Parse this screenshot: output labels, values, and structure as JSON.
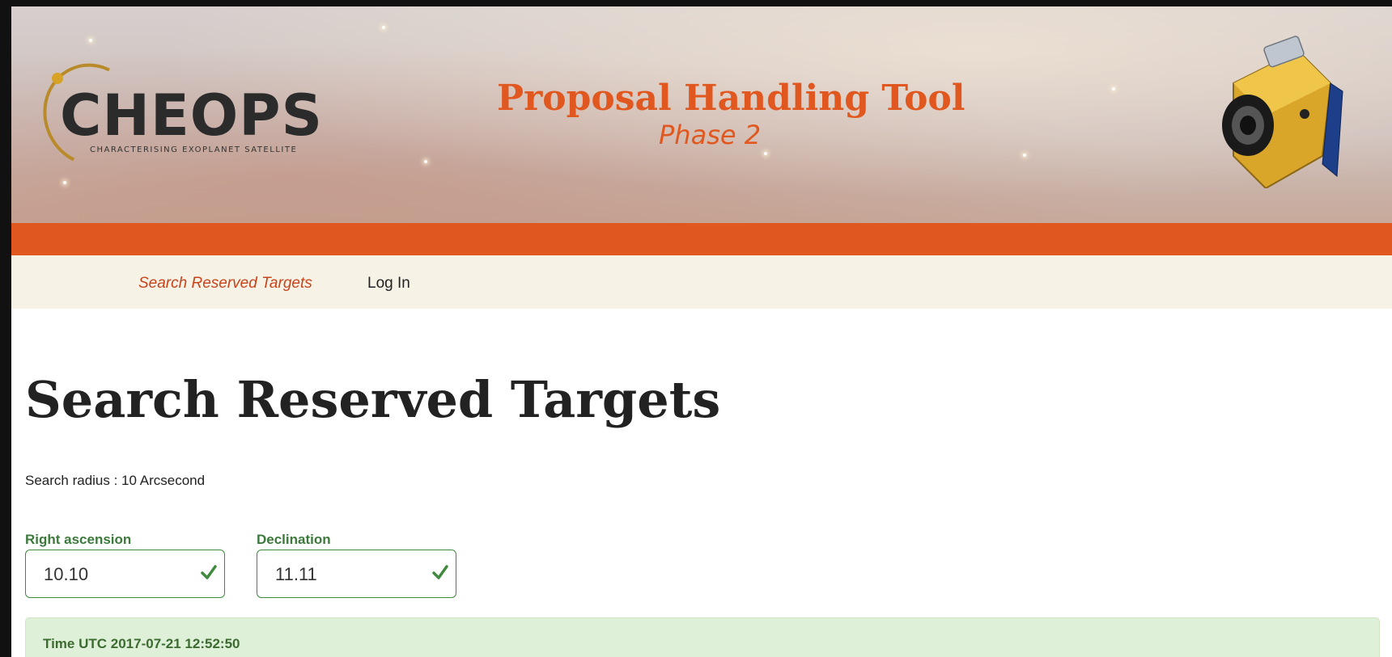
{
  "header": {
    "logo_text": "CHEOPS",
    "logo_subtitle": "CHARACTERISING EXOPLANET SATELLITE",
    "tool_title": "Proposal Handling Tool",
    "tool_subtitle": "Phase 2",
    "satellite_icon": "satellite-icon"
  },
  "nav": {
    "items": [
      {
        "label": "Search Reserved Targets",
        "active": true
      },
      {
        "label": "Log In",
        "active": false
      }
    ]
  },
  "main": {
    "title": "Search Reserved Targets",
    "radius_text": "Search radius : 10 Arcsecond",
    "fields": [
      {
        "label": "Right ascension",
        "value": "10.10",
        "valid": true
      },
      {
        "label": "Declination",
        "value": "11.11",
        "valid": true
      }
    ],
    "alert": "Time UTC 2017-07-21 12:52:50"
  },
  "colors": {
    "accent": "#e0581f",
    "nav_bg": "#f6f3e6",
    "valid": "#3f8a3f",
    "alert_bg": "#dff0d8"
  }
}
